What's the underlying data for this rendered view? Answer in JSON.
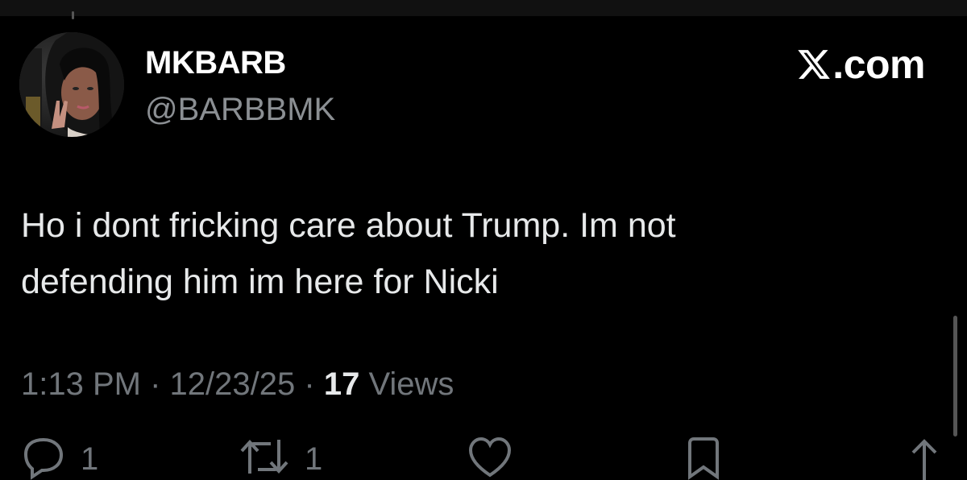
{
  "author": {
    "display_name": "MKBARB",
    "handle": "@BARBBMK"
  },
  "brand": {
    "label": ".com",
    "icon": "x-logo-icon"
  },
  "tweet": {
    "line1": "Ho i dont fricking care about Trump. Im not",
    "line2": "defending him im here for Nicki"
  },
  "meta": {
    "time": "1:13 PM",
    "date": "12/23/25",
    "separator": "·",
    "views_count": "17",
    "views_label": "Views"
  },
  "actions": {
    "reply_count": "1",
    "repost_count": "1"
  },
  "colors": {
    "background": "#000000",
    "text": "#e7e9ea",
    "muted": "#71767b"
  }
}
